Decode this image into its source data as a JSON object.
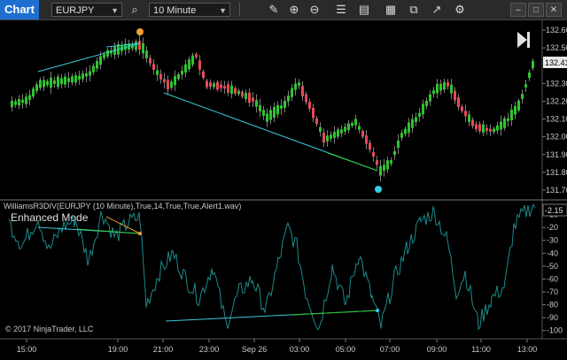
{
  "toolbar": {
    "tab_label": "Chart",
    "instrument": "EURJPY",
    "interval": "10 Minute",
    "icons": [
      "search-icon",
      "pencil-icon",
      "zoom-in-icon",
      "zoom-out-icon",
      "properties-icon",
      "bar-style-icon",
      "indicators-icon",
      "strategies-icon",
      "chart-trader-icon",
      "settings-icon"
    ]
  },
  "price_panel": {
    "current_price": "132.41",
    "y_labels": [
      "132.60",
      "132.50",
      "132.30",
      "132.20",
      "132.10",
      "132.00",
      "131.90",
      "131.80",
      "131.70"
    ],
    "y_values": [
      132.6,
      132.5,
      132.3,
      132.2,
      132.1,
      132.0,
      131.9,
      131.8,
      131.7
    ],
    "ylim": [
      131.66,
      132.64
    ],
    "colors": {
      "up": "#2ec42e",
      "down": "#e8485a",
      "trendline": "#3cc8d8",
      "signal_top": "#f0a030",
      "signal_bottom": "#30d0e8"
    }
  },
  "indicator_panel": {
    "title": "WilliamsR3DIV(EURJPY (10 Minute),True,14,True,True,Alert1.wav)",
    "mode_label": "Enhanced Mode",
    "current_value": "-2.15",
    "y_labels": [
      "-10",
      "-20",
      "-30",
      "-40",
      "-50",
      "-60",
      "-70",
      "-80",
      "-90",
      "-100"
    ],
    "y_values": [
      -10,
      -20,
      -30,
      -40,
      -50,
      -60,
      -70,
      -80,
      -90,
      -100
    ],
    "ylim": [
      -105,
      0
    ],
    "line_color": "#1c8a8a",
    "copyright": "© 2017 NinjaTrader, LLC"
  },
  "x_axis": {
    "labels": [
      "15:00",
      "19:00",
      "21:00",
      "23:00",
      "Sep 26",
      "03:00",
      "05:00",
      "07:00",
      "09:00",
      "11:00",
      "13:00"
    ]
  }
}
